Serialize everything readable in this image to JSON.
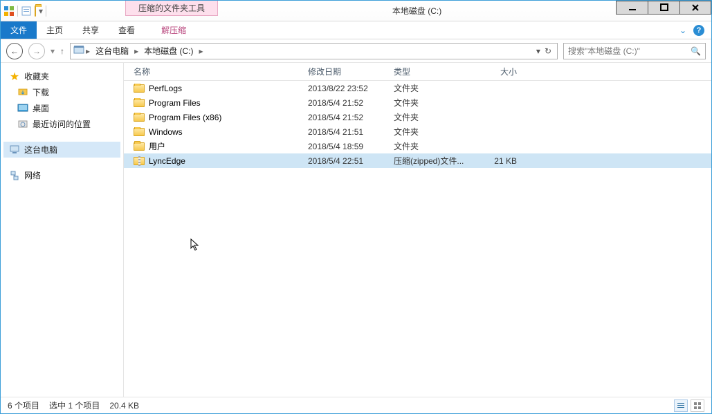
{
  "window": {
    "context_tab_header": "压缩的文件夹工具",
    "title": "本地磁盘 (C:)"
  },
  "ribbon": {
    "file": "文件",
    "home": "主页",
    "share": "共享",
    "view": "查看",
    "extract": "解压缩"
  },
  "breadcrumb": {
    "root": "这台电脑",
    "loc": "本地磁盘 (C:)"
  },
  "search": {
    "placeholder": "搜索\"本地磁盘 (C:)\""
  },
  "nav": {
    "favorites": "收藏夹",
    "downloads": "下载",
    "desktop": "桌面",
    "recent": "最近访问的位置",
    "thispc": "这台电脑",
    "network": "网络"
  },
  "columns": {
    "name": "名称",
    "date": "修改日期",
    "type": "类型",
    "size": "大小"
  },
  "rows": [
    {
      "name": "PerfLogs",
      "date": "2013/8/22 23:52",
      "type": "文件夹",
      "size": "",
      "kind": "folder",
      "sel": false
    },
    {
      "name": "Program Files",
      "date": "2018/5/4 21:52",
      "type": "文件夹",
      "size": "",
      "kind": "folder",
      "sel": false
    },
    {
      "name": "Program Files (x86)",
      "date": "2018/5/4 21:52",
      "type": "文件夹",
      "size": "",
      "kind": "folder",
      "sel": false
    },
    {
      "name": "Windows",
      "date": "2018/5/4 21:51",
      "type": "文件夹",
      "size": "",
      "kind": "folder",
      "sel": false
    },
    {
      "name": "用户",
      "date": "2018/5/4 18:59",
      "type": "文件夹",
      "size": "",
      "kind": "folder",
      "sel": false
    },
    {
      "name": "LyncEdge",
      "date": "2018/5/4 22:51",
      "type": "压缩(zipped)文件...",
      "size": "21 KB",
      "kind": "zip",
      "sel": true
    }
  ],
  "status": {
    "count": "6 个项目",
    "selection": "选中 1 个项目",
    "size": "20.4 KB"
  }
}
